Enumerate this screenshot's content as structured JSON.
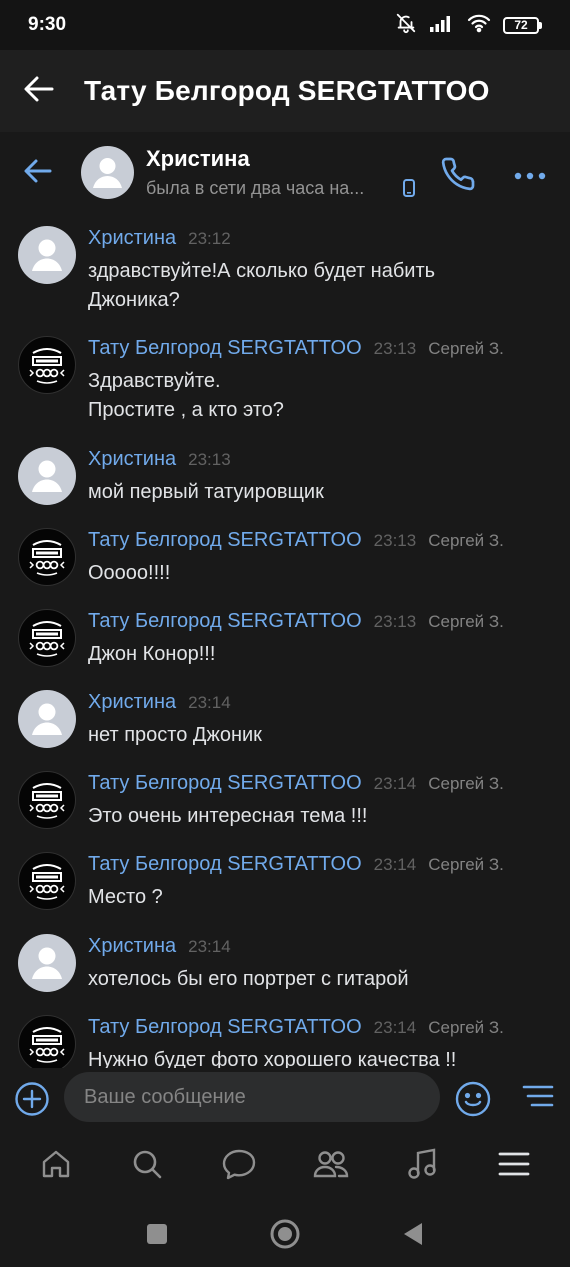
{
  "status_bar": {
    "time": "9:30",
    "battery": "72"
  },
  "app_header": {
    "title": "Тату Белгород SERGTATTOO"
  },
  "chat_header": {
    "name": "Христина",
    "status": "была в сети два часа на..."
  },
  "messages": [
    {
      "author": "Христина",
      "time": "23:12",
      "agent": "",
      "text": "здравствуйте!А сколько будет набить\nДжоника?",
      "avatar": "user-avatar"
    },
    {
      "author": "Тату Белгород SERGTATTOO",
      "time": "23:13",
      "agent": "Сергей З.",
      "text": "Здравствуйте.\nПростите , а кто это?",
      "avatar": "studio-logo-avatar"
    },
    {
      "author": "Христина",
      "time": "23:13",
      "agent": "",
      "text": "мой первый татуировщик",
      "avatar": "user-avatar"
    },
    {
      "author": "Тату Белгород SERGTATTOO",
      "time": "23:13",
      "agent": "Сергей З.",
      "text": "Ооооо!!!!",
      "avatar": "studio-logo-avatar"
    },
    {
      "author": "Тату Белгород SERGTATTOO",
      "time": "23:13",
      "agent": "Сергей З.",
      "text": "Джон Конор!!!",
      "avatar": "studio-logo-avatar"
    },
    {
      "author": "Христина",
      "time": "23:14",
      "agent": "",
      "text": "нет просто Джоник",
      "avatar": "user-avatar"
    },
    {
      "author": "Тату Белгород SERGTATTOO",
      "time": "23:14",
      "agent": "Сергей З.",
      "text": "Это очень интересная тема !!!",
      "avatar": "studio-logo-avatar"
    },
    {
      "author": "Тату Белгород SERGTATTOO",
      "time": "23:14",
      "agent": "Сергей З.",
      "text": "Место ?",
      "avatar": "studio-logo-avatar"
    },
    {
      "author": "Христина",
      "time": "23:14",
      "agent": "",
      "text": "хотелось бы его портрет с гитарой",
      "avatar": "user-avatar"
    },
    {
      "author": "Тату Белгород SERGTATTOO",
      "time": "23:14",
      "agent": "Сергей З.",
      "text": "Нужно будет фото хорошего качества !!",
      "avatar": "studio-logo-avatar"
    }
  ],
  "composer": {
    "placeholder": "Ваше сообщение"
  },
  "tabs": [
    {
      "icon": "home-icon"
    },
    {
      "icon": "search-icon"
    },
    {
      "icon": "messages-icon"
    },
    {
      "icon": "friends-icon"
    },
    {
      "icon": "music-icon"
    },
    {
      "icon": "menu-icon"
    }
  ],
  "colors": {
    "accent": "#71aaeb",
    "background": "#191919",
    "header": "#1f1f1f",
    "text": "#e1e3e6",
    "secondary_text": "#939393"
  }
}
